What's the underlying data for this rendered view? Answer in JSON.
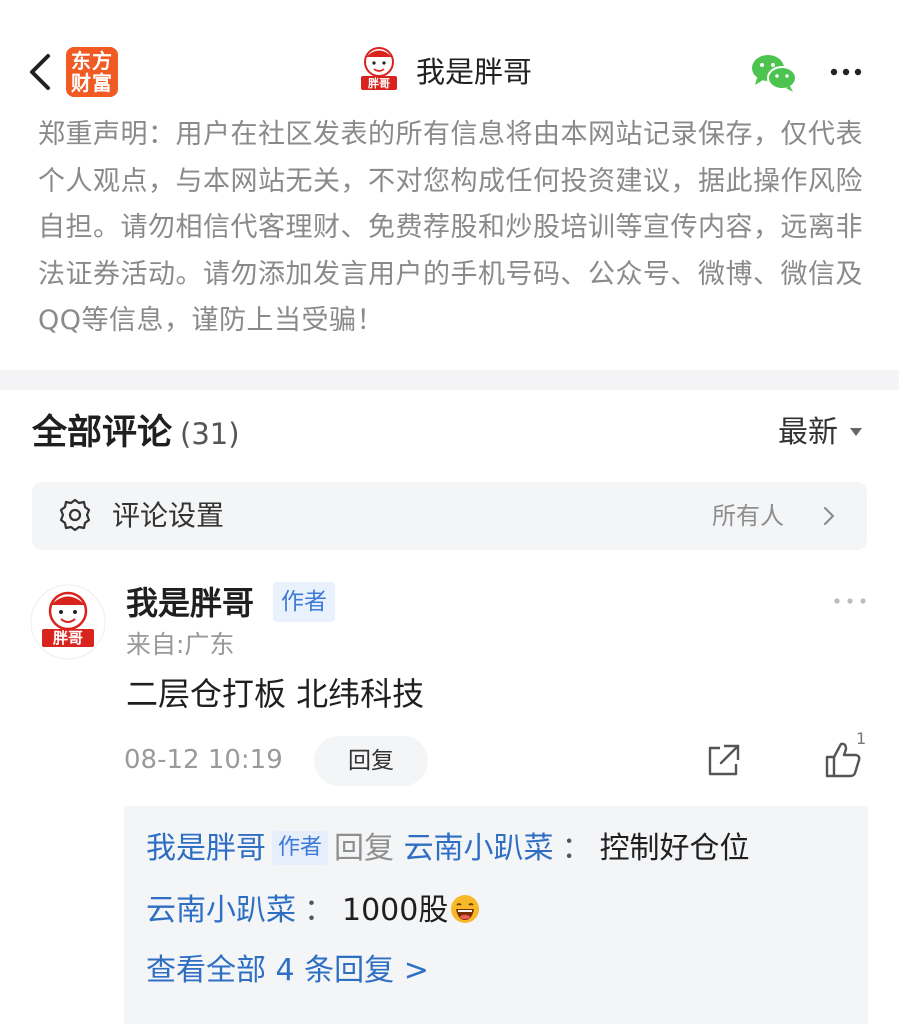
{
  "header": {
    "logo_line1": "东方",
    "logo_line2": "财富",
    "avatar_text": "胖哥",
    "title": "我是胖哥",
    "icons": [
      "chevron-left-icon",
      "wechat-icon",
      "more-horizontal-icon"
    ]
  },
  "disclaimer": "郑重声明：用户在社区发表的所有信息将由本网站记录保存，仅代表个人观点，与本网站无关，不对您构成任何投资建议，据此操作风险自担。请勿相信代客理财、免费荐股和炒股培训等宣传内容，远离非法证券活动。请勿添加发言用户的手机号码、公众号、微博、微信及QQ等信息，谨防上当受骗！",
  "comments": {
    "title": "全部评论",
    "count": "(31)",
    "sort_label": "最新"
  },
  "settings": {
    "label": "评论设置",
    "value": "所有人"
  },
  "comment": {
    "avatar_text": "胖哥",
    "author": "我是胖哥",
    "badge": "作者",
    "location": "来自:广东",
    "body": "二层仓打板 北纬科技",
    "time": "08-12 10:19",
    "reply_label": "回复",
    "like_count": "1",
    "replies": [
      {
        "author": "我是胖哥",
        "badge": "作者",
        "action": "回复",
        "target": "云南小趴菜",
        "colon": "：",
        "text": "控制好仓位"
      },
      {
        "author": "云南小趴菜",
        "colon": "：",
        "text": "1000股",
        "emoji": "laughing-face-emoji"
      }
    ],
    "view_all": "查看全部 4 条回复 >"
  },
  "colors": {
    "brand": "#f15a22",
    "link": "#2e6fc4",
    "badge_bg": "#e9f1fc",
    "panel_bg": "#f4f5f7"
  }
}
